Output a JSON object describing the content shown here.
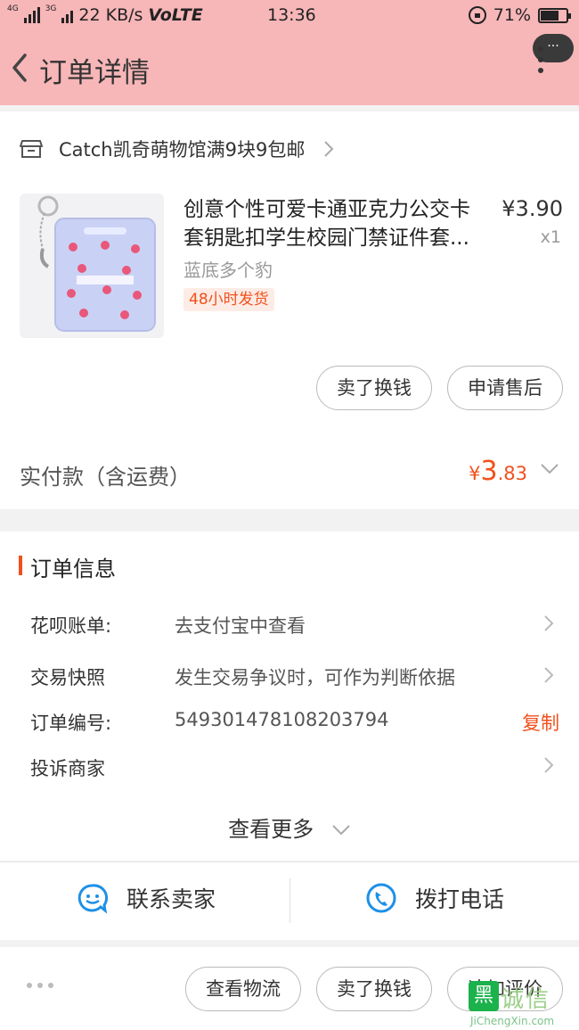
{
  "status_bar": {
    "net_top": "4G",
    "net_mid": "3G",
    "speed": "22 KB/s",
    "volte": "VoLTE",
    "time": "13:36",
    "battery": "71%",
    "battery_level": 0.71
  },
  "header": {
    "title": "订单详情",
    "more_pill": "···"
  },
  "store": {
    "name": "Catch凯奇萌物馆满9块9包邮"
  },
  "product": {
    "title_line1": "创意个性可爱卡通亚克力公交卡",
    "title_line2": "套钥匙扣学生校园门禁证件套...",
    "price": "¥3.90",
    "qty": "x1",
    "sku": "蓝底多个豹",
    "ship_tag": "48小时发货",
    "btn_sell": "卖了换钱",
    "btn_aftersale": "申请售后"
  },
  "payment": {
    "label": "实付款（含运费）",
    "currency": "¥",
    "amount_int": "3",
    "amount_dec": ".83"
  },
  "order_info": {
    "title": "订单信息",
    "huabei_label": "花呗账单:",
    "huabei_value": "去支付宝中查看",
    "snapshot_label": "交易快照",
    "snapshot_value": "发生交易争议时，可作为判断依据",
    "order_no_label": "订单编号:",
    "order_no_value": "549301478108203794",
    "copy": "复制",
    "complain_label": "投诉商家",
    "see_more": "查看更多"
  },
  "contact": {
    "seller": "联系卖家",
    "phone": "拨打电话"
  },
  "bottom": {
    "logistics": "查看物流",
    "sell": "卖了换钱",
    "review": "追加评价"
  },
  "watermark": {
    "logo_char": "黑",
    "cn": "诚信",
    "en": "JiChengXin.com"
  },
  "colors": {
    "header_bg": "#f7b6b8",
    "accent": "#f2501c",
    "blue": "#1e90e6"
  }
}
